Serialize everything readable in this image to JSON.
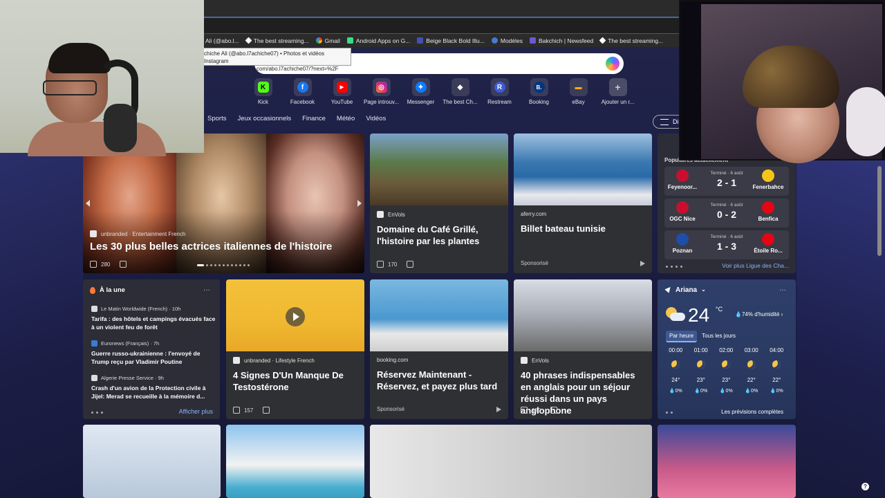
{
  "bookmarks": [
    {
      "label": "Ali (@abo.l...",
      "icon": "instagram-icon"
    },
    {
      "label": "The best streaming...",
      "icon": "diamond-icon"
    },
    {
      "label": "Gmail",
      "icon": "google-icon"
    },
    {
      "label": "Android Apps on G...",
      "icon": "android-icon"
    },
    {
      "label": "Beige Black Bold Illu...",
      "icon": "canva-icon"
    },
    {
      "label": "Modèles",
      "icon": "edge-icon"
    },
    {
      "label": "Bakchich | Newsfeed",
      "icon": "bakchich-icon"
    },
    {
      "label": "The best streaming...",
      "icon": "diamond-icon"
    }
  ],
  "tooltip": {
    "line1": "chiche Ali (@abo.l7achiche07) • Photos et vidéos Instagram",
    "line2": "ttps://www.instagram.com/abo.l7achiche07/?next=%2F"
  },
  "quicklinks": [
    {
      "label": "Kick",
      "letter": "K",
      "color": "#53fc18",
      "fg": "#000"
    },
    {
      "label": "Facebook",
      "letter": "f",
      "color": "#1877f2",
      "fg": "#fff"
    },
    {
      "label": "YouTube",
      "letter": "▶",
      "color": "#ff0000",
      "fg": "#fff"
    },
    {
      "label": "Page introuv...",
      "letter": "◎",
      "color": "#d6249f",
      "fg": "#fff"
    },
    {
      "label": "Messenger",
      "letter": "✦",
      "color": "#0a7cff",
      "fg": "#fff"
    },
    {
      "label": "The best Ch...",
      "letter": "◆",
      "color": "#3a3c5a",
      "fg": "#fff"
    },
    {
      "label": "Restream",
      "letter": "R",
      "color": "#3b5bdb",
      "fg": "#fff"
    },
    {
      "label": "Booking",
      "letter": "B.",
      "color": "#003580",
      "fg": "#fff"
    },
    {
      "label": "eBay",
      "letter": "▬",
      "color": "#3a3c5a",
      "fg": "#f5af02"
    },
    {
      "label": "Ajouter un r...",
      "letter": "+",
      "color": "#4a4c68",
      "fg": "#ccc"
    }
  ],
  "nav": [
    "Sports",
    "Jeux occasionnels",
    "Finance",
    "Météo",
    "Vidéos"
  ],
  "filter_label": "Di",
  "hero": {
    "source": "unbranded · Entertainment French",
    "title": "Les 30 plus belles actrices italiennes de l'histoire",
    "likes": "280"
  },
  "cards": {
    "cafe": {
      "source": "EnVols",
      "title": "Domaine du Café Grillé, l'histoire par les plantes",
      "likes": "170"
    },
    "bateau": {
      "source": "aferry.com",
      "title": "Billet bateau tunisie",
      "sponsored": "Sponsorisé"
    },
    "testo": {
      "source": "unbranded · Lifestyle French",
      "title": "4 Signes D'Un Manque De Testostérone",
      "likes": "157"
    },
    "booking": {
      "source": "booking.com",
      "title": "Réservez Maintenant - Réservez, et payez plus tard",
      "sponsored": "Sponsorisé"
    },
    "anglais": {
      "source": "EnVols",
      "title": "40 phrases indispensables en anglais pour un séjour réussi dans un pays anglophone",
      "likes": "185"
    }
  },
  "sports": {
    "header": "Populaires actuellement",
    "more": "Voir plus Ligue des Cha...",
    "matches": [
      {
        "home": "Feyenoor...",
        "away": "Fenerbahce",
        "status": "Terminé · 6 août",
        "score": "2 - 1",
        "home_color": "#c8102e",
        "away_color": "#f5c518"
      },
      {
        "home": "OGC Nice",
        "away": "Benfica",
        "status": "Terminé · 6 août",
        "score": "0 - 2",
        "home_color": "#c8102e",
        "away_color": "#e30613"
      },
      {
        "home": "Poznan",
        "away": "Étoile Ro...",
        "status": "Terminé · 6 août",
        "score": "1 - 3",
        "home_color": "#1e4ea8",
        "away_color": "#e30613"
      }
    ]
  },
  "newslist": {
    "header": "À la une",
    "items": [
      {
        "source": "Le Matin Worldwide (French) · 10h",
        "title": "Tarifa : des hôtels et campings évacués face à un violent feu de forêt"
      },
      {
        "source": "Euronews (Français) · 7h",
        "title": "Guerre russo-ukrainienne : l'envoyé de Trump reçu par Vladimir Poutine"
      },
      {
        "source": "Algerie Presse Service · 9h",
        "title": "Crash d'un avion de la Protection civile à Jijel: Merad se recueille à la mémoire d..."
      }
    ],
    "show_more": "Afficher plus"
  },
  "weather": {
    "location": "Ariana",
    "temp": "24",
    "unit": "°C",
    "humidity": "74% d'humidité",
    "tab_hourly": "Par heure",
    "tab_daily": "Tous les jours",
    "hours": [
      {
        "time": "00:00",
        "temp": "24°",
        "precip": "0%"
      },
      {
        "time": "01:00",
        "temp": "23°",
        "precip": "0%"
      },
      {
        "time": "02:00",
        "temp": "23°",
        "precip": "0%"
      },
      {
        "time": "03:00",
        "temp": "22°",
        "precip": "0%"
      },
      {
        "time": "04:00",
        "temp": "22°",
        "precip": "0%"
      }
    ],
    "full_forecast": "Les prévisions complètes"
  }
}
